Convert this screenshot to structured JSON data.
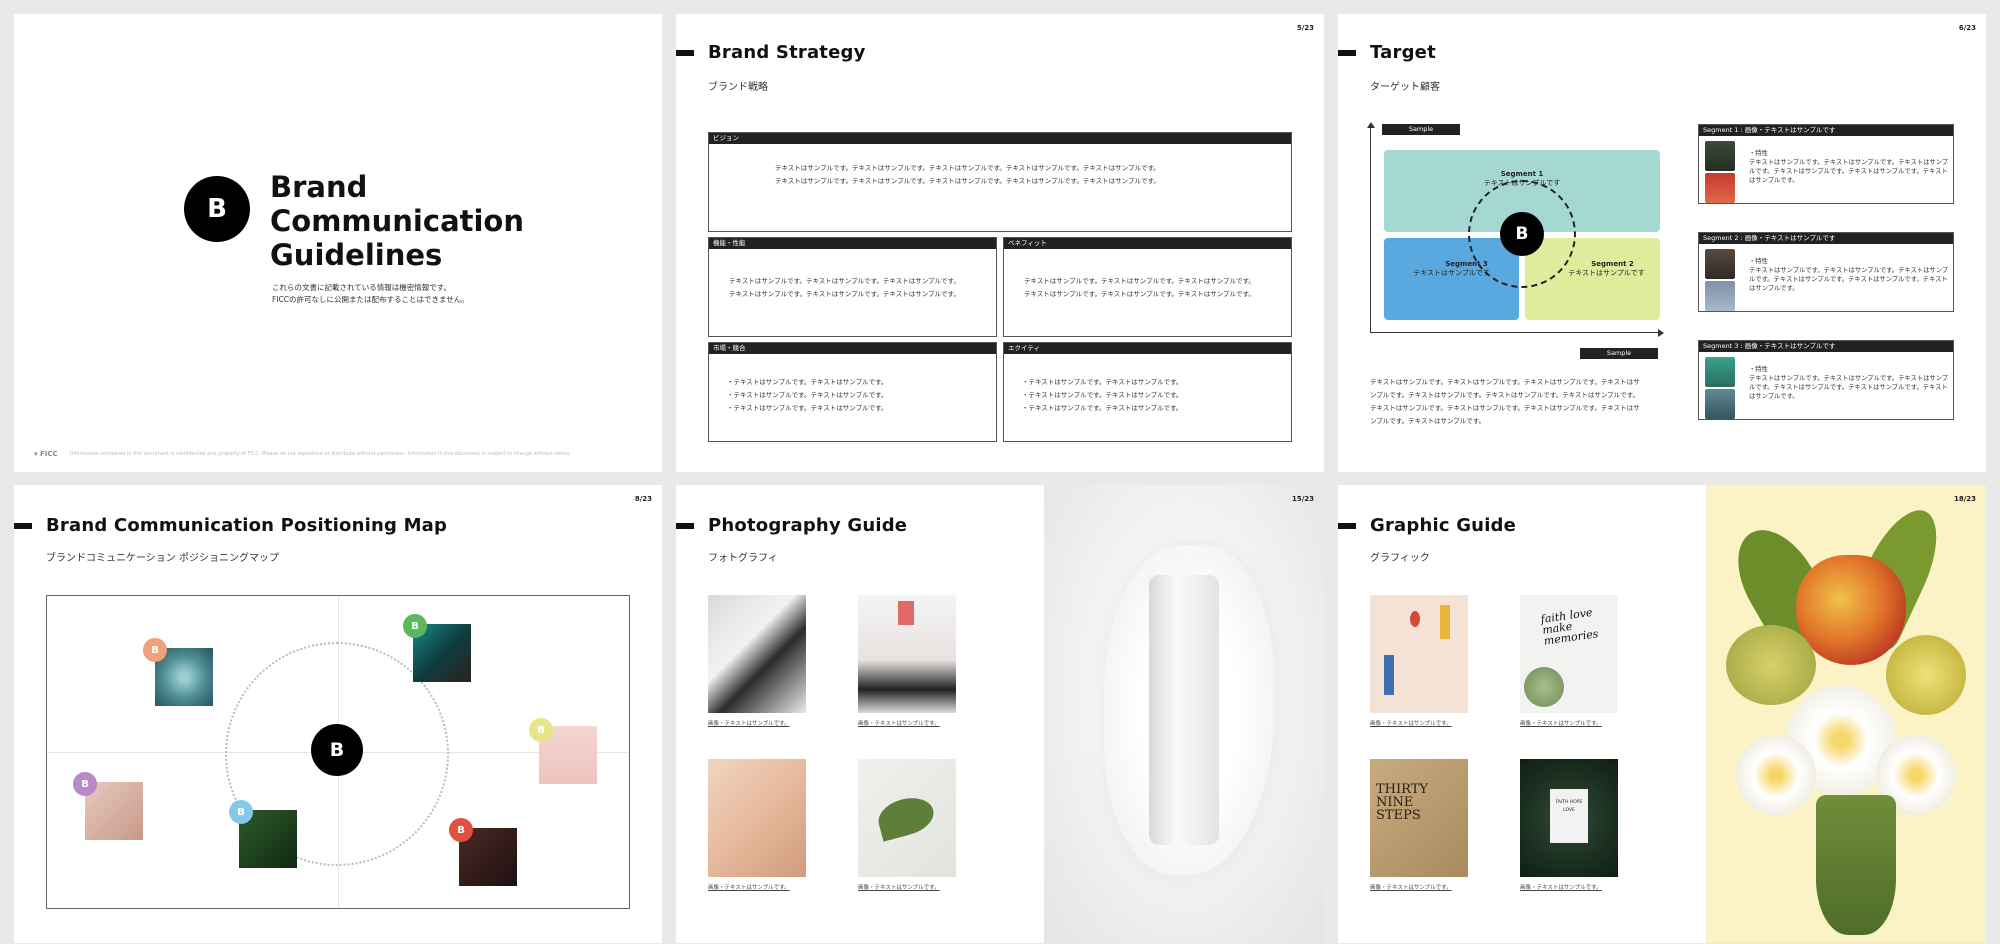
{
  "slide1": {
    "logo_letter": "B",
    "title_l1": "Brand",
    "title_l2": "Communication",
    "title_l3": "Guidelines",
    "note_l1": "これらの文書に記載されている情報は機密情報です。",
    "note_l2": "FICCの許可なしに公開または配布することはできません。",
    "footer_logo": "▾ FICC",
    "footer_note": "Information contained in this document is confidential and property of FICC. Please do not reproduce or distribute without permission. Information in this document is subject to change without notice."
  },
  "slide2": {
    "page": "5/23",
    "title": "Brand Strategy",
    "subtitle": "ブランド戦略",
    "vision": {
      "label": "ビジョン",
      "l1": "テキストはサンプルです。テキストはサンプルです。テキストはサンプルです。テキストはサンプルです。テキストはサンプルです。",
      "l2": "テキストはサンプルです。テキストはサンプルです。テキストはサンプルです。テキストはサンプルです。テキストはサンプルです。"
    },
    "function": {
      "label": "機能・性能",
      "l1": "テキストはサンプルです。テキストはサンプルです。テキストはサンプルです。",
      "l2": "テキストはサンプルです。テキストはサンプルです。テキストはサンプルです。"
    },
    "benefit": {
      "label": "ベネフィット",
      "l1": "テキストはサンプルです。テキストはサンプルです。テキストはサンプルです。",
      "l2": "テキストはサンプルです。テキストはサンプルです。テキストはサンプルです。"
    },
    "market": {
      "label": "市場・競合",
      "items": [
        "テキストはサンプルです。テキストはサンプルです。",
        "テキストはサンプルです。テキストはサンプルです。",
        "テキストはサンプルです。テキストはサンプルです。"
      ]
    },
    "equity": {
      "label": "エクイティ",
      "items": [
        "テキストはサンプルです。テキストはサンプルです。",
        "テキストはサンプルです。テキストはサンプルです。",
        "テキストはサンプルです。テキストはサンプルです。"
      ]
    }
  },
  "slide3": {
    "page": "6/23",
    "title": "Target",
    "subtitle": "ターゲット顧客",
    "sample_top": "Sample",
    "sample_right": "Sample",
    "center_letter": "B",
    "seg1_label": "Segment 1",
    "seg1_text": "テキストはサンプルです",
    "seg2_label": "Segment 2",
    "seg2_text": "テキストはサンプルです",
    "seg3_label": "Segment 3",
    "seg3_text": "テキストはサンプルです",
    "body_l1": "テキストはサンプルです。テキストはサンプルです。テキストはサンプルです。テキストはサ",
    "body_l2": "ンプルです。テキストはサンプルです。テキストはサンプルです。テキストはサンプルです。",
    "body_l3": "テキストはサンプルです。テキストはサンプルです。テキストはサンプルです。テキストはサ",
    "body_l4": "ンプルです。テキストはサンプルです。",
    "cards": [
      {
        "head": "Segment 1 : 画像・テキストはサンプルです",
        "feature": "・特性",
        "text": "テキストはサンプルです。テキストはサンプルです。テキストはサンプルです。テキストはサンプルです。テキストはサンプルです。テキストはサンプルです。"
      },
      {
        "head": "Segment 2 : 画像・テキストはサンプルです",
        "feature": "・特性",
        "text": "テキストはサンプルです。テキストはサンプルです。テキストはサンプルです。テキストはサンプルです。テキストはサンプルです。テキストはサンプルです。"
      },
      {
        "head": "Segment 3 : 画像・テキストはサンプルです",
        "feature": "・特性",
        "text": "テキストはサンプルです。テキストはサンプルです。テキストはサンプルです。テキストはサンプルです。テキストはサンプルです。テキストはサンプルです。"
      }
    ],
    "colors": {
      "seg1": "#a6d8d2",
      "seg2": "#dfec9c",
      "seg3": "#5aa8e0"
    }
  },
  "slide4": {
    "page": "8/23",
    "title": "Brand Communication Positioning Map",
    "subtitle": "ブランドコミュニケーション ポジショニングマップ",
    "center_letter": "B",
    "dot_letter": "B",
    "dot_colors": {
      "orange": "#f0a07a",
      "green": "#5cb85c",
      "yellow": "#e6e58a",
      "purple": "#b98ac8",
      "blue": "#86c8ea",
      "red": "#e2503f"
    }
  },
  "slide5": {
    "page": "15/23",
    "title": "Photography Guide",
    "subtitle": "フォトグラフィ",
    "caption": "画像・テキストはサンプルです。"
  },
  "slide6": {
    "page": "18/23",
    "title": "Graphic Guide",
    "subtitle": "グラフィック",
    "caption": "画像・テキストはサンプルです。",
    "art_text_1": "faith love make memories",
    "art_text_2": "THIRTY NINE STEPS",
    "art_text_3": "FAITH HOPE LOVE"
  }
}
